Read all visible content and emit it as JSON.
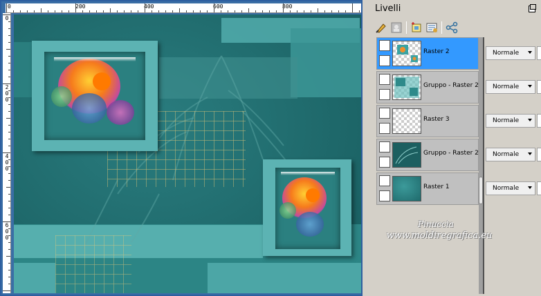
{
  "ruler": {
    "top_labels": [
      "0",
      "200",
      "400",
      "600",
      "800"
    ],
    "left_labels": [
      [
        "0"
      ],
      [
        "2",
        "0",
        "0"
      ],
      [
        "4",
        "0",
        "0"
      ],
      [
        "6",
        "0",
        "0"
      ]
    ]
  },
  "panel": {
    "title": "Livelli",
    "toolbar_icons": [
      "paint-brush-icon",
      "mask-icon",
      "new-layer-icon",
      "layer-properties-icon",
      "link-icon"
    ]
  },
  "layers": [
    {
      "name": "Raster 2",
      "blend": "Normale",
      "selected": true
    },
    {
      "name": "Gruppo - Raster 2",
      "blend": "Normale",
      "selected": false
    },
    {
      "name": "Raster 3",
      "blend": "Normale",
      "selected": false
    },
    {
      "name": "Gruppo - Raster 2",
      "blend": "Normale",
      "selected": false
    },
    {
      "name": "Raster 1",
      "blend": "Normale",
      "selected": false
    }
  ],
  "watermark": {
    "line1": "Pinuccia",
    "line2": "www.moldiregrafica.eu"
  },
  "colors": {
    "canvas_bg": "#1f6a6c",
    "light_teal": "#5cb3b3",
    "selection": "#3399ff"
  }
}
